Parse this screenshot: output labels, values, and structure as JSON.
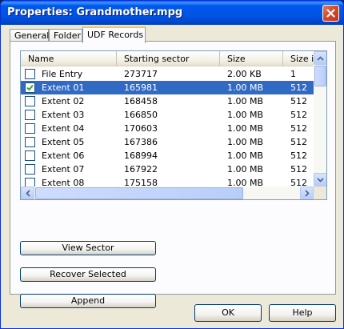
{
  "window": {
    "title": "Properties: Grandmother.mpg"
  },
  "tabs": [
    {
      "label": "General",
      "active": false
    },
    {
      "label": "Folder",
      "active": false
    },
    {
      "label": "UDF Records",
      "active": true
    }
  ],
  "list": {
    "columns": [
      "Name",
      "Starting sector",
      "Size",
      "Size in"
    ],
    "rows": [
      {
        "checked": false,
        "selected": false,
        "name": "File Entry",
        "sector": "273717",
        "size": "2.00 KB",
        "size_in": "1"
      },
      {
        "checked": true,
        "selected": true,
        "name": "Extent 01",
        "sector": "165981",
        "size": "1.00 MB",
        "size_in": "512"
      },
      {
        "checked": false,
        "selected": false,
        "name": "Extent 02",
        "sector": "168458",
        "size": "1.00 MB",
        "size_in": "512"
      },
      {
        "checked": false,
        "selected": false,
        "name": "Extent 03",
        "sector": "166850",
        "size": "1.00 MB",
        "size_in": "512"
      },
      {
        "checked": false,
        "selected": false,
        "name": "Extent 04",
        "sector": "170603",
        "size": "1.00 MB",
        "size_in": "512"
      },
      {
        "checked": false,
        "selected": false,
        "name": "Extent 05",
        "sector": "167386",
        "size": "1.00 MB",
        "size_in": "512"
      },
      {
        "checked": false,
        "selected": false,
        "name": "Extent 06",
        "sector": "168994",
        "size": "1.00 MB",
        "size_in": "512"
      },
      {
        "checked": false,
        "selected": false,
        "name": "Extent 07",
        "sector": "167922",
        "size": "1.00 MB",
        "size_in": "512"
      },
      {
        "checked": false,
        "selected": false,
        "name": "Extent 08",
        "sector": "175158",
        "size": "1.00 MB",
        "size_in": "512"
      }
    ]
  },
  "actions": {
    "view_sector": "View Sector",
    "recover_selected": "Recover Selected",
    "append": "Append"
  },
  "footer": {
    "ok": "OK",
    "help": "Help"
  },
  "icons": {
    "close": "close-icon",
    "check": "checkmark-icon",
    "scroll_up": "arrow-up-icon",
    "scroll_down": "arrow-down-icon",
    "scroll_left": "arrow-left-icon",
    "scroll_right": "arrow-right-icon"
  },
  "colors": {
    "titlebar": "#0054E3",
    "selection": "#316AC5",
    "active_tab_accent": "#FFC83C"
  }
}
